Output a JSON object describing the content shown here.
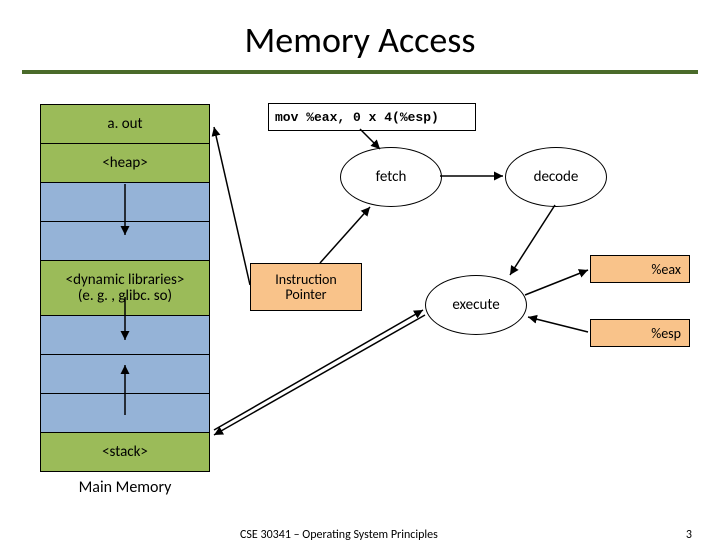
{
  "title": "Memory Access",
  "memory": {
    "rows": {
      "aout": "a. out",
      "heap": "<heap>",
      "dynlib_line1": "<dynamic libraries>",
      "dynlib_line2": "(e. g. , glibc. so)",
      "stack": "<stack>"
    },
    "label": "Main Memory"
  },
  "instruction": "mov %eax, 0 x 4(%esp)",
  "nodes": {
    "fetch": "fetch",
    "decode": "decode",
    "execute": "execute",
    "ip_line1": "Instruction",
    "ip_line2": "Pointer"
  },
  "registers": {
    "eax": "%eax",
    "esp": "%esp"
  },
  "footer": {
    "course": "CSE 30341 – Operating System Principles",
    "page": "3"
  },
  "colors": {
    "accent_rule": "#4a6b2a",
    "mem_green": "#9bbb59",
    "mem_blue": "#95b3d7",
    "box_orange": "#f9c38a"
  }
}
